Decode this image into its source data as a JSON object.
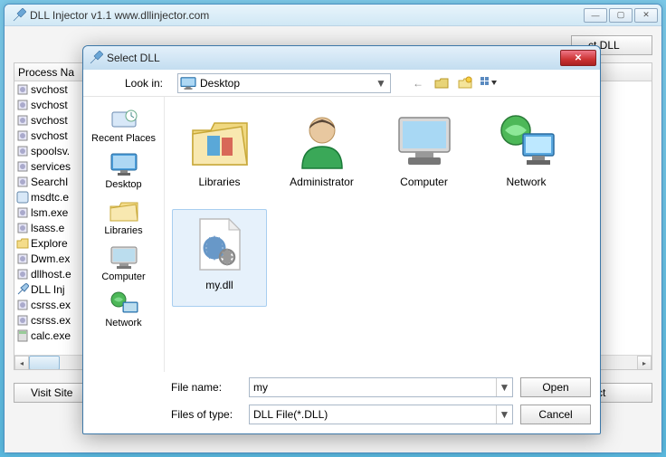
{
  "main": {
    "title": "DLL Injector v1.1   www.dllinjector.com",
    "select_dll_btn": "ct DLL",
    "process_header": "Process Na",
    "visit_site_btn": "Visit Site",
    "processes": [
      {
        "name": "svchost",
        "icon": "gear"
      },
      {
        "name": "svchost",
        "icon": "gear"
      },
      {
        "name": "svchost",
        "icon": "gear"
      },
      {
        "name": "svchost",
        "icon": "gear"
      },
      {
        "name": "spoolsv.",
        "icon": "gear"
      },
      {
        "name": "services",
        "icon": "gear"
      },
      {
        "name": "SearchI",
        "icon": "gear"
      },
      {
        "name": "msdtc.e",
        "icon": "app"
      },
      {
        "name": "lsm.exe",
        "icon": "gear"
      },
      {
        "name": "lsass.e",
        "icon": "gear"
      },
      {
        "name": "Explore",
        "icon": "folder"
      },
      {
        "name": "Dwm.ex",
        "icon": "gear"
      },
      {
        "name": "dllhost.e",
        "icon": "gear"
      },
      {
        "name": "DLL Inj",
        "icon": "syringe"
      },
      {
        "name": "csrss.ex",
        "icon": "gear"
      },
      {
        "name": "csrss.ex",
        "icon": "gear"
      },
      {
        "name": "calc.exe",
        "icon": "calc"
      }
    ]
  },
  "dialog": {
    "title": "Select DLL",
    "lookin_label": "Look in:",
    "lookin_value": "Desktop",
    "places": [
      {
        "label": "Recent Places",
        "icon": "recent"
      },
      {
        "label": "Desktop",
        "icon": "desktop"
      },
      {
        "label": "Libraries",
        "icon": "libraries"
      },
      {
        "label": "Computer",
        "icon": "computer"
      },
      {
        "label": "Network",
        "icon": "network"
      }
    ],
    "files": [
      {
        "label": "Libraries",
        "icon": "libraries-big",
        "selected": false
      },
      {
        "label": "Administrator",
        "icon": "user-big",
        "selected": false
      },
      {
        "label": "Computer",
        "icon": "computer-big",
        "selected": false
      },
      {
        "label": "Network",
        "icon": "network-big",
        "selected": false
      },
      {
        "label": "my.dll",
        "icon": "dll-big",
        "selected": true
      }
    ],
    "filename_label": "File name:",
    "filename_value": "my",
    "filetype_label": "Files of type:",
    "filetype_value": "DLL File(*.DLL)",
    "open_btn": "Open",
    "cancel_btn": "Cancel"
  }
}
